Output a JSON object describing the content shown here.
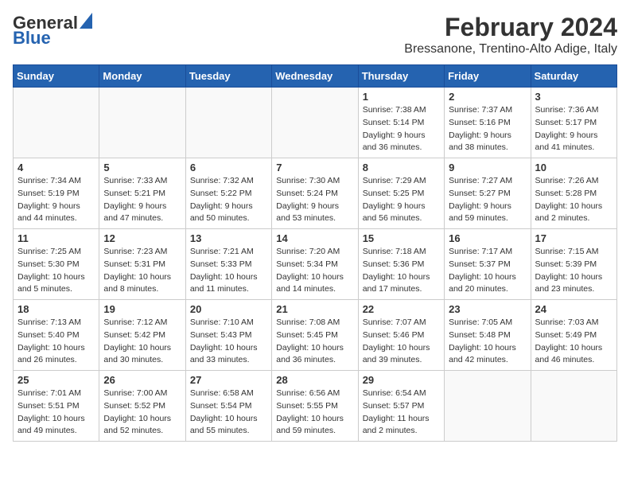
{
  "header": {
    "logo_line1": "General",
    "logo_line2": "Blue",
    "title": "February 2024",
    "subtitle": "Bressanone, Trentino-Alto Adige, Italy"
  },
  "days_of_week": [
    "Sunday",
    "Monday",
    "Tuesday",
    "Wednesday",
    "Thursday",
    "Friday",
    "Saturday"
  ],
  "weeks": [
    [
      {
        "day": "",
        "info": ""
      },
      {
        "day": "",
        "info": ""
      },
      {
        "day": "",
        "info": ""
      },
      {
        "day": "",
        "info": ""
      },
      {
        "day": "1",
        "info": "Sunrise: 7:38 AM\nSunset: 5:14 PM\nDaylight: 9 hours\nand 36 minutes."
      },
      {
        "day": "2",
        "info": "Sunrise: 7:37 AM\nSunset: 5:16 PM\nDaylight: 9 hours\nand 38 minutes."
      },
      {
        "day": "3",
        "info": "Sunrise: 7:36 AM\nSunset: 5:17 PM\nDaylight: 9 hours\nand 41 minutes."
      }
    ],
    [
      {
        "day": "4",
        "info": "Sunrise: 7:34 AM\nSunset: 5:19 PM\nDaylight: 9 hours\nand 44 minutes."
      },
      {
        "day": "5",
        "info": "Sunrise: 7:33 AM\nSunset: 5:21 PM\nDaylight: 9 hours\nand 47 minutes."
      },
      {
        "day": "6",
        "info": "Sunrise: 7:32 AM\nSunset: 5:22 PM\nDaylight: 9 hours\nand 50 minutes."
      },
      {
        "day": "7",
        "info": "Sunrise: 7:30 AM\nSunset: 5:24 PM\nDaylight: 9 hours\nand 53 minutes."
      },
      {
        "day": "8",
        "info": "Sunrise: 7:29 AM\nSunset: 5:25 PM\nDaylight: 9 hours\nand 56 minutes."
      },
      {
        "day": "9",
        "info": "Sunrise: 7:27 AM\nSunset: 5:27 PM\nDaylight: 9 hours\nand 59 minutes."
      },
      {
        "day": "10",
        "info": "Sunrise: 7:26 AM\nSunset: 5:28 PM\nDaylight: 10 hours\nand 2 minutes."
      }
    ],
    [
      {
        "day": "11",
        "info": "Sunrise: 7:25 AM\nSunset: 5:30 PM\nDaylight: 10 hours\nand 5 minutes."
      },
      {
        "day": "12",
        "info": "Sunrise: 7:23 AM\nSunset: 5:31 PM\nDaylight: 10 hours\nand 8 minutes."
      },
      {
        "day": "13",
        "info": "Sunrise: 7:21 AM\nSunset: 5:33 PM\nDaylight: 10 hours\nand 11 minutes."
      },
      {
        "day": "14",
        "info": "Sunrise: 7:20 AM\nSunset: 5:34 PM\nDaylight: 10 hours\nand 14 minutes."
      },
      {
        "day": "15",
        "info": "Sunrise: 7:18 AM\nSunset: 5:36 PM\nDaylight: 10 hours\nand 17 minutes."
      },
      {
        "day": "16",
        "info": "Sunrise: 7:17 AM\nSunset: 5:37 PM\nDaylight: 10 hours\nand 20 minutes."
      },
      {
        "day": "17",
        "info": "Sunrise: 7:15 AM\nSunset: 5:39 PM\nDaylight: 10 hours\nand 23 minutes."
      }
    ],
    [
      {
        "day": "18",
        "info": "Sunrise: 7:13 AM\nSunset: 5:40 PM\nDaylight: 10 hours\nand 26 minutes."
      },
      {
        "day": "19",
        "info": "Sunrise: 7:12 AM\nSunset: 5:42 PM\nDaylight: 10 hours\nand 30 minutes."
      },
      {
        "day": "20",
        "info": "Sunrise: 7:10 AM\nSunset: 5:43 PM\nDaylight: 10 hours\nand 33 minutes."
      },
      {
        "day": "21",
        "info": "Sunrise: 7:08 AM\nSunset: 5:45 PM\nDaylight: 10 hours\nand 36 minutes."
      },
      {
        "day": "22",
        "info": "Sunrise: 7:07 AM\nSunset: 5:46 PM\nDaylight: 10 hours\nand 39 minutes."
      },
      {
        "day": "23",
        "info": "Sunrise: 7:05 AM\nSunset: 5:48 PM\nDaylight: 10 hours\nand 42 minutes."
      },
      {
        "day": "24",
        "info": "Sunrise: 7:03 AM\nSunset: 5:49 PM\nDaylight: 10 hours\nand 46 minutes."
      }
    ],
    [
      {
        "day": "25",
        "info": "Sunrise: 7:01 AM\nSunset: 5:51 PM\nDaylight: 10 hours\nand 49 minutes."
      },
      {
        "day": "26",
        "info": "Sunrise: 7:00 AM\nSunset: 5:52 PM\nDaylight: 10 hours\nand 52 minutes."
      },
      {
        "day": "27",
        "info": "Sunrise: 6:58 AM\nSunset: 5:54 PM\nDaylight: 10 hours\nand 55 minutes."
      },
      {
        "day": "28",
        "info": "Sunrise: 6:56 AM\nSunset: 5:55 PM\nDaylight: 10 hours\nand 59 minutes."
      },
      {
        "day": "29",
        "info": "Sunrise: 6:54 AM\nSunset: 5:57 PM\nDaylight: 11 hours\nand 2 minutes."
      },
      {
        "day": "",
        "info": ""
      },
      {
        "day": "",
        "info": ""
      }
    ]
  ]
}
